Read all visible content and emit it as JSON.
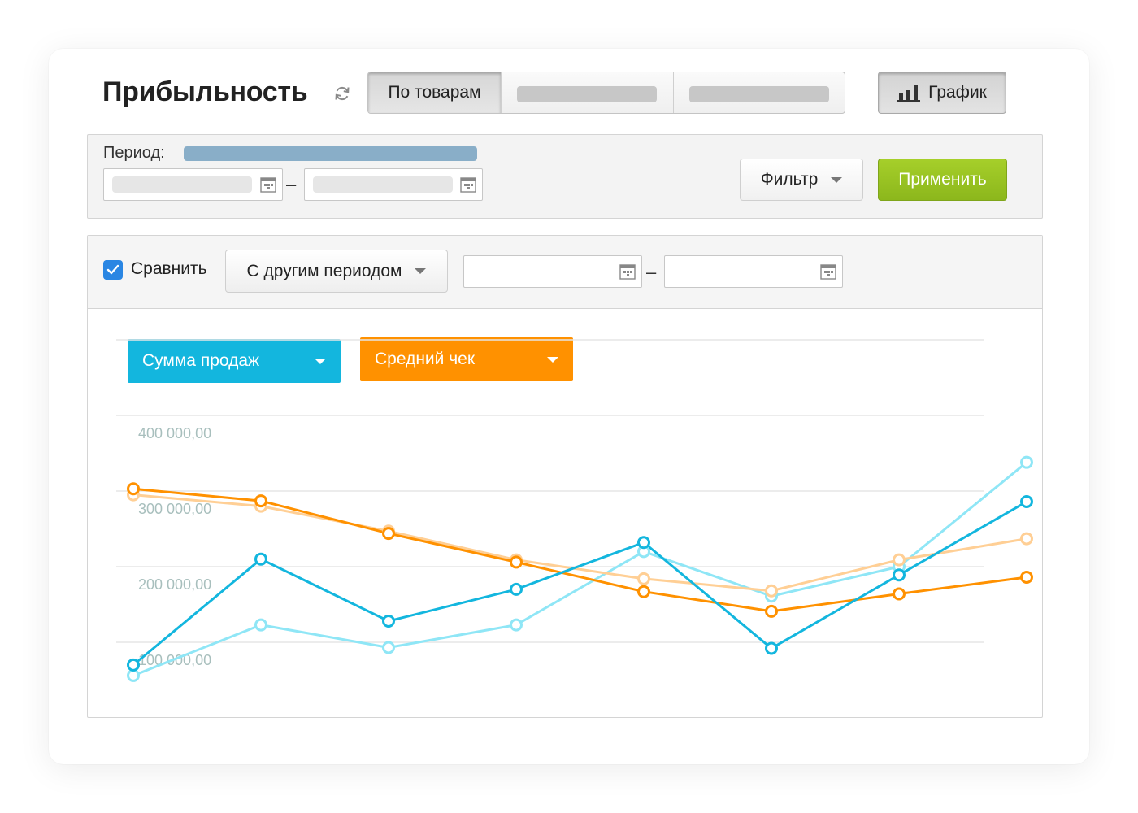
{
  "header": {
    "title": "Прибыльность",
    "tabs": [
      {
        "label": "По товарам",
        "active": true
      },
      {
        "label": "",
        "placeholder": true
      },
      {
        "label": "",
        "placeholder": true
      }
    ],
    "chart_button_label": "График"
  },
  "period": {
    "label": "Период:",
    "filter_label": "Фильтр",
    "apply_label": "Применить",
    "separator": "–"
  },
  "compare": {
    "checked": true,
    "label": "Сравнить",
    "mode_label": "С другим периодом",
    "separator": "–"
  },
  "metrics": {
    "primary_label": "Сумма продаж",
    "primary_color": "#13b6de",
    "secondary_label": "Средний чек",
    "secondary_color": "#ff9100"
  },
  "colors": {
    "apply": "#9bc425",
    "checkbox": "#2a86e3",
    "period_highlight": "#89aec8"
  },
  "chart_data": {
    "type": "line",
    "y_tick_labels": [
      "400 000,00",
      "300 000,00",
      "200 000,00",
      "100 000,00"
    ],
    "y_ticks": [
      400000,
      300000,
      200000,
      100000
    ],
    "x": [
      1,
      2,
      3,
      4,
      5,
      6,
      7,
      8
    ],
    "ylim": [
      100000,
      400000
    ],
    "grid": true,
    "series": [
      {
        "metric": "Сумма продаж",
        "period": "current",
        "color": "#13b6de",
        "values": [
          70000,
          210000,
          128000,
          170000,
          232000,
          92000,
          189000,
          286000
        ]
      },
      {
        "metric": "Сумма продаж",
        "period": "comparison",
        "color": "#8fe6f6",
        "values": [
          56000,
          123000,
          93000,
          123000,
          220000,
          161000,
          200000,
          338000
        ]
      },
      {
        "metric": "Средний чек",
        "period": "current",
        "color": "#ff9100",
        "values": [
          303000,
          287000,
          244000,
          206000,
          167000,
          141000,
          164000,
          186000
        ]
      },
      {
        "metric": "Средний чек",
        "period": "comparison",
        "color": "#ffcf95",
        "values": [
          295000,
          280000,
          247000,
          209000,
          184000,
          168000,
          209000,
          237000
        ]
      }
    ]
  }
}
